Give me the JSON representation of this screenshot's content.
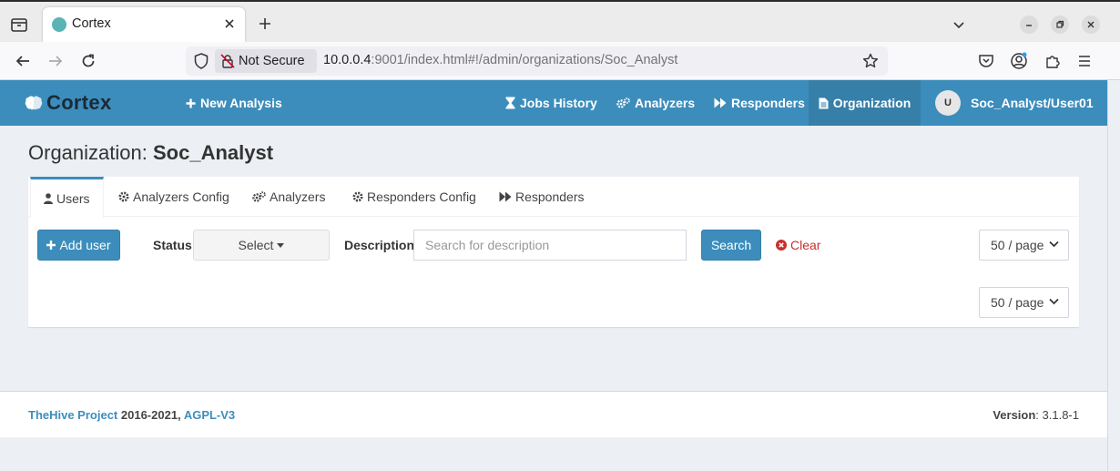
{
  "browser": {
    "tab_title": "Cortex",
    "security_label": "Not Secure",
    "url_host": "10.0.0.4",
    "url_rest": ":9001/index.html#!/admin/organizations/Soc_Analyst"
  },
  "app": {
    "logo_text": "Cortex",
    "nav": {
      "new_analysis": "New Analysis",
      "jobs_history": "Jobs History",
      "analyzers": "Analyzers",
      "responders": "Responders",
      "organization": "Organization",
      "user_initial": "U",
      "user_name": "Soc_Analyst/User01"
    }
  },
  "page": {
    "title_prefix": "Organization:",
    "title_name": "Soc_Analyst",
    "tabs": {
      "users": "Users",
      "analyzers_config": "Analyzers Config",
      "analyzers": "Analyzers",
      "responders_config": "Responders Config",
      "responders": "Responders"
    },
    "toolbar": {
      "add_user": "Add user",
      "status_label": "Status",
      "status_select": "Select",
      "description_label": "Description",
      "description_placeholder": "Search for description",
      "search": "Search",
      "clear": "Clear",
      "page_size_top": "50 / page",
      "page_size_bottom": "50 / page"
    }
  },
  "footer": {
    "project_link": "TheHive Project",
    "years": "2016-2021,",
    "license_link": "AGPL-V3",
    "version_label": "Version",
    "version_value": ": 3.1.8-1"
  },
  "colors": {
    "primary": "#3c8dbc",
    "primary_dark": "#367fa9",
    "danger": "#c9302c",
    "background": "#ecf0f5"
  }
}
